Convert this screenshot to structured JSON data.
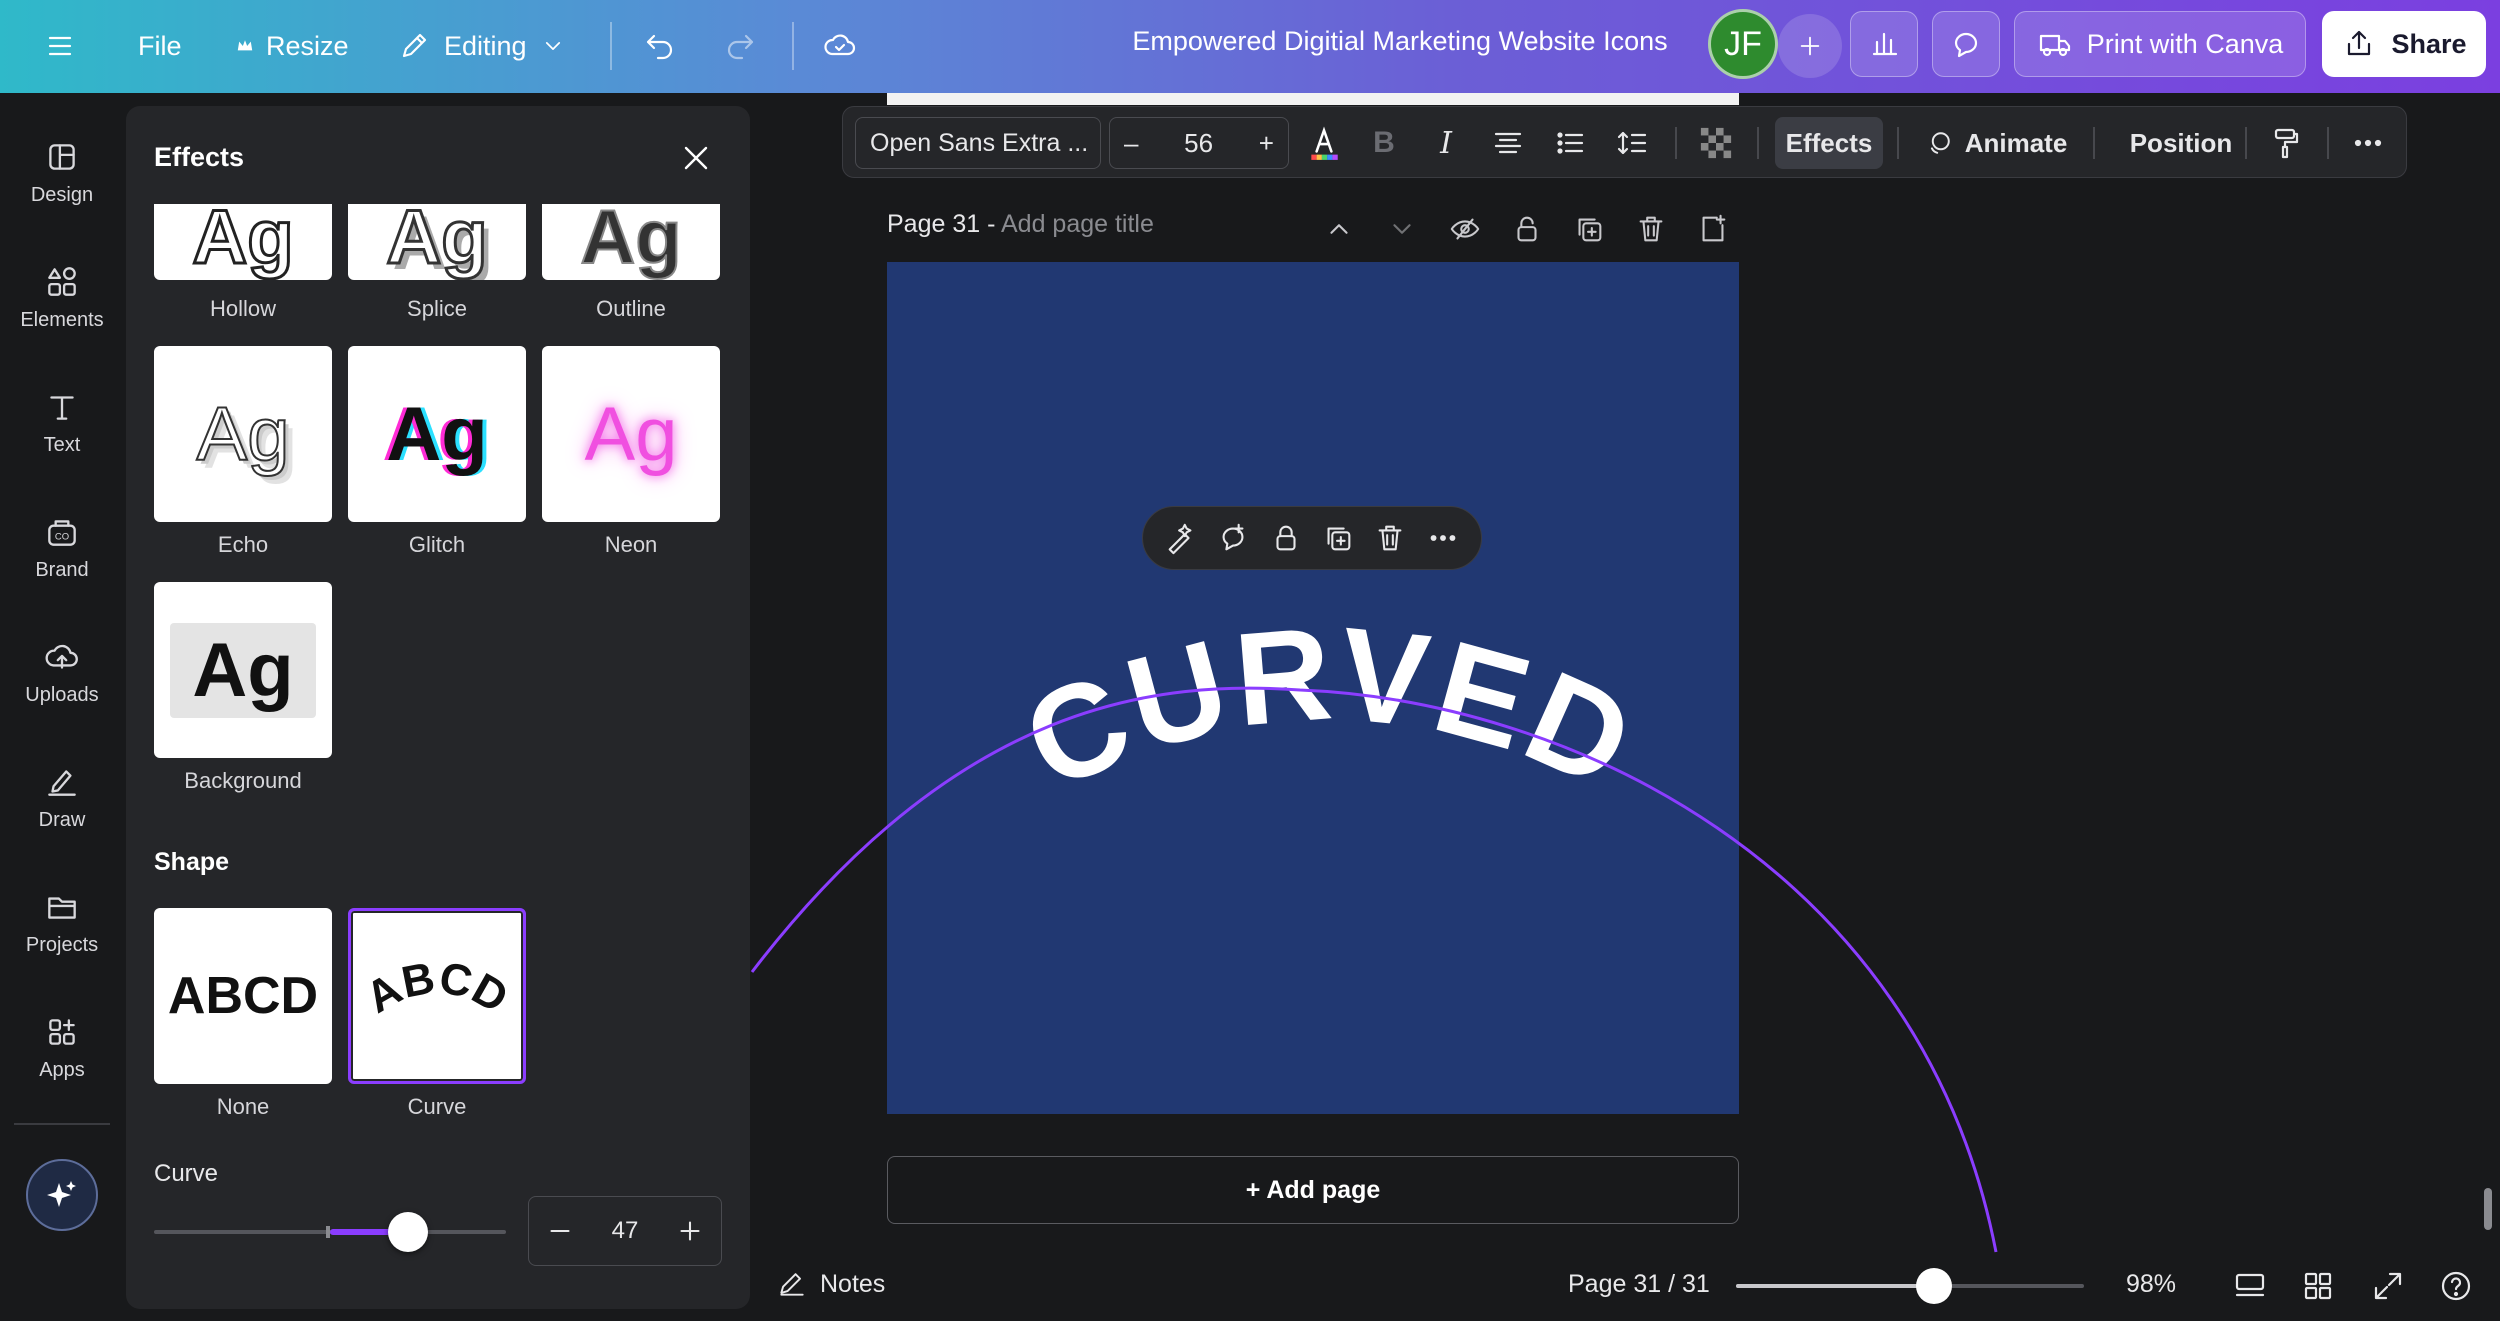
{
  "topbar": {
    "file_label": "File",
    "resize_label": "Resize",
    "editing_label": "Editing",
    "doc_title": "Empowered Digitial Marketing Website Icons",
    "avatar_initials": "JF",
    "print_label": "Print with Canva",
    "share_label": "Share"
  },
  "rail": {
    "items": [
      {
        "label": "Design",
        "icon": "design-icon"
      },
      {
        "label": "Elements",
        "icon": "elements-icon"
      },
      {
        "label": "Text",
        "icon": "text-icon"
      },
      {
        "label": "Brand",
        "icon": "brand-icon"
      },
      {
        "label": "Uploads",
        "icon": "uploads-icon"
      },
      {
        "label": "Draw",
        "icon": "draw-icon"
      },
      {
        "label": "Projects",
        "icon": "projects-icon"
      },
      {
        "label": "Apps",
        "icon": "apps-icon"
      }
    ]
  },
  "effects_panel": {
    "title": "Effects",
    "styles": [
      {
        "label": "Hollow",
        "sample": "Ag"
      },
      {
        "label": "Splice",
        "sample": "Ag"
      },
      {
        "label": "Outline",
        "sample": "Ag"
      },
      {
        "label": "Echo",
        "sample": "Ag"
      },
      {
        "label": "Glitch",
        "sample": "Ag"
      },
      {
        "label": "Neon",
        "sample": "Ag"
      },
      {
        "label": "Background",
        "sample": "Ag"
      }
    ],
    "shape_heading": "Shape",
    "shapes": [
      {
        "label": "None",
        "sample": "ABCD"
      },
      {
        "label": "Curve",
        "sample": "ABCD",
        "selected": true
      }
    ],
    "curve_label": "Curve",
    "curve_value": "47",
    "curve_level_percent": 47
  },
  "text_toolbar": {
    "font_name": "Open Sans Extra ...",
    "font_size": "56",
    "effects_label": "Effects",
    "animate_label": "Animate",
    "position_label": "Position"
  },
  "canvas": {
    "page_label": "Page 31 -",
    "page_title_placeholder": "Add page title",
    "curved_text": "CURVED",
    "add_page_label": "+ Add page"
  },
  "bottombar": {
    "notes_label": "Notes",
    "page_indicator": "Page 31 / 31",
    "zoom_label": "98%",
    "zoom_percent": 98
  },
  "colors": {
    "accent": "#8b3dff",
    "canvas_bg": "#213872",
    "avatar_bg": "#2e8b2e"
  }
}
